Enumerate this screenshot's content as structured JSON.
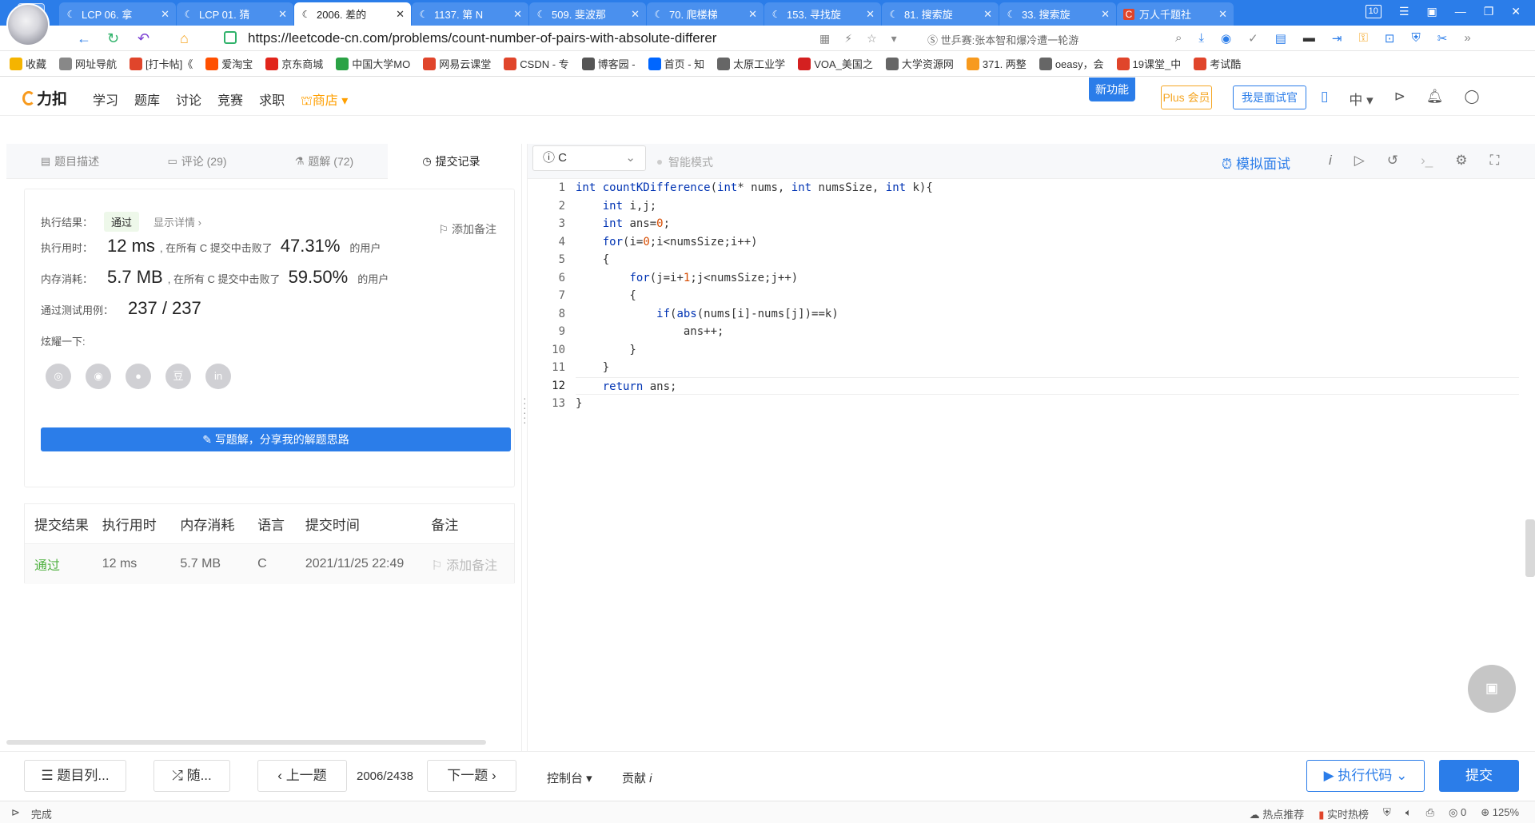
{
  "browser": {
    "tabs": [
      {
        "label": "LCP 06. 拿",
        "active": false
      },
      {
        "label": "LCP 01. 猜",
        "active": false
      },
      {
        "label": "2006. 差的",
        "active": true
      },
      {
        "label": "1137. 第 N",
        "active": false
      },
      {
        "label": "509. 斐波那",
        "active": false
      },
      {
        "label": "70. 爬楼梯",
        "active": false
      },
      {
        "label": "153. 寻找旋",
        "active": false
      },
      {
        "label": "81. 搜索旋",
        "active": false
      },
      {
        "label": "33. 搜索旋",
        "active": false
      },
      {
        "label": "万人千题社",
        "active": false
      }
    ],
    "tab_count_badge": "10",
    "url": "https://leetcode-cn.com/problems/count-number-of-pairs-with-absolute-differer",
    "url_domain": "leetcode-cn.com",
    "search_suggestion": "世乒赛:张本智和爆冷遭一轮游",
    "bookmarks": [
      {
        "label": "收藏",
        "icon": "star-icon",
        "color": "#f5b400"
      },
      {
        "label": "网址导航",
        "icon": "globe-icon",
        "color": "#888888"
      },
      {
        "label": "[打卡帖]《",
        "icon": "csdn-icon",
        "color": "#e0452b"
      },
      {
        "label": "爱淘宝",
        "icon": "taobao-icon",
        "color": "#ff5000"
      },
      {
        "label": "京东商城",
        "icon": "jd-icon",
        "color": "#e1251b"
      },
      {
        "label": "中国大学MO",
        "icon": "mooc-icon",
        "color": "#2ba245"
      },
      {
        "label": "网易云课堂",
        "icon": "netease-icon",
        "color": "#e0452b"
      },
      {
        "label": "CSDN - 专",
        "icon": "csdn-icon",
        "color": "#e0452b"
      },
      {
        "label": "博客园 -",
        "icon": "cnblogs-icon",
        "color": "#555555"
      },
      {
        "label": "首页 - 知",
        "icon": "zhihu-icon",
        "color": "#0066ff"
      },
      {
        "label": "太原工业学",
        "icon": "doc-icon",
        "color": "#666666"
      },
      {
        "label": "VOA_美国之",
        "icon": "voa-icon",
        "color": "#d42020"
      },
      {
        "label": "大学资源网",
        "icon": "doc-icon",
        "color": "#666666"
      },
      {
        "label": "371. 两整",
        "icon": "leetcode-icon",
        "color": "#f79a1e"
      },
      {
        "label": "oeasy，会",
        "icon": "doc-icon",
        "color": "#666666"
      },
      {
        "label": "19课堂_中",
        "icon": "ketang-icon",
        "color": "#e0452b"
      },
      {
        "label": "考试酷",
        "icon": "kaoshiku-icon",
        "color": "#e0452b"
      }
    ]
  },
  "header": {
    "logo": "力扣",
    "nav": [
      "学习",
      "题库",
      "讨论",
      "竞赛",
      "求职"
    ],
    "shop": "商店",
    "new_feature": "新功能",
    "plus": "Plus 会员",
    "interviewer": "我是面试官",
    "lang": "中"
  },
  "left": {
    "tabs": [
      {
        "label": "题目描述",
        "icon": "description-icon"
      },
      {
        "label": "评论 (29)",
        "icon": "comment-icon"
      },
      {
        "label": "题解 (72)",
        "icon": "solution-icon"
      },
      {
        "label": "提交记录",
        "icon": "clock-icon"
      }
    ],
    "result": {
      "label_result": "执行结果：",
      "status": "通过",
      "show_details": "显示详情 ›",
      "add_note": "添加备注",
      "label_time": "执行用时：",
      "time_value": "12 ms",
      "time_text": ", 在所有 C 提交中击败了",
      "time_pct": "47.31%",
      "users": "的用户",
      "label_memory": "内存消耗：",
      "memory_value": "5.7 MB",
      "memory_text": ", 在所有 C 提交中击败了",
      "memory_pct": "59.50%",
      "label_tests": "通过测试用例：",
      "tests_value": "237 / 237",
      "share_label": "炫耀一下:",
      "write_solution": "写题解，分享我的解题思路"
    },
    "table": {
      "headers": [
        "提交结果",
        "执行用时",
        "内存消耗",
        "语言",
        "提交时间",
        "备注"
      ],
      "rows": [
        {
          "status": "通过",
          "time": "12 ms",
          "memory": "5.7 MB",
          "lang": "C",
          "date": "2021/11/25 22:49",
          "note": "添加备注"
        }
      ]
    }
  },
  "editor": {
    "language": "C",
    "smart_mode": "智能模式",
    "mock_interview": "模拟面试",
    "code_lines": [
      "int countKDifference(int* nums, int numsSize, int k){",
      "    int i,j;",
      "    int ans=0;",
      "    for(i=0;i<numsSize;i++)",
      "    {",
      "        for(j=i+1;j<numsSize;j++)",
      "        {",
      "            if(abs(nums[i]-nums[j])==k)",
      "                ans++;",
      "        }",
      "    }",
      "    return ans;",
      "}"
    ]
  },
  "bottom": {
    "problem_list": "题目列...",
    "random": "随...",
    "prev": "上一题",
    "progress": "2006/2438",
    "next": "下一题",
    "console": "控制台",
    "contribute": "贡献",
    "run": "执行代码",
    "submit": "提交"
  },
  "status": {
    "done": "完成",
    "hot_recommend": "热点推荐",
    "realtime": "实时热榜",
    "count": "0",
    "zoom": "125%"
  }
}
